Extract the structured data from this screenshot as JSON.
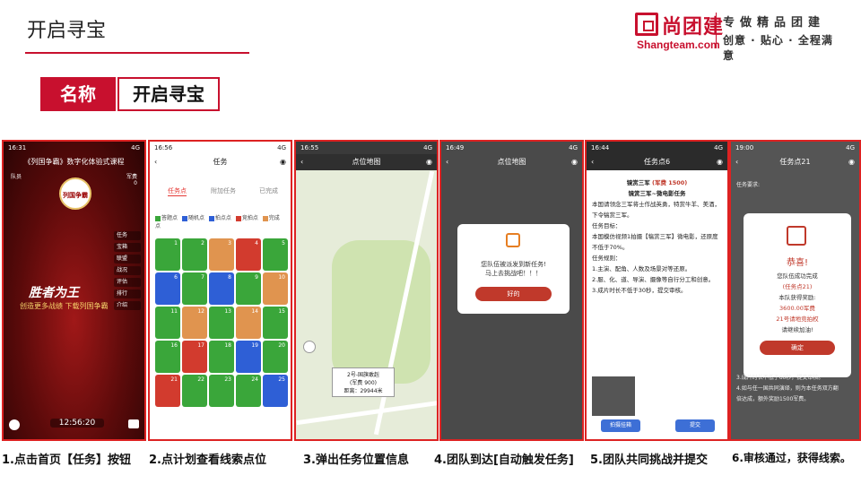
{
  "page_title": "开启寻宝",
  "logo": {
    "name": "尚团建",
    "domain": "Shangteam.com",
    "slogan_top": "专做精品团建",
    "slogan_bottom": "创意 · 贴心 · 全程满意"
  },
  "name_row": {
    "label": "名称",
    "value": "开启寻宝"
  },
  "phones": {
    "p1": {
      "time": "16:31",
      "signal": "4G",
      "title": "《列国争霸》数字化体验式课程",
      "team_label": "队员",
      "score_label": "军费",
      "score_value": "0",
      "emblem_text": "列国争霸",
      "side_menu": [
        "任务",
        "宝箱",
        "联盟",
        "战况",
        "评估",
        "排行",
        "介绍"
      ],
      "slogan": "胜者为王",
      "slogan_sub": "创造更多战绩 下载列国争霸",
      "timer": "12:56:20"
    },
    "p2": {
      "time": "16:56",
      "signal": "4G",
      "nav_title": "任务",
      "tabs": [
        "任务点",
        "附加任务",
        "已完成"
      ],
      "legend": [
        "答题点",
        "随机点",
        "拍点点",
        "竞拍点",
        "完成点"
      ],
      "cells": [
        {
          "n": "1",
          "c": "#3aa63a"
        },
        {
          "n": "2",
          "c": "#3aa63a"
        },
        {
          "n": "3",
          "c": "#e0944f"
        },
        {
          "n": "4",
          "c": "#d23b2e"
        },
        {
          "n": "5",
          "c": "#3aa63a"
        },
        {
          "n": "6",
          "c": "#2e5fd6"
        },
        {
          "n": "7",
          "c": "#3aa63a"
        },
        {
          "n": "8",
          "c": "#2e5fd6"
        },
        {
          "n": "9",
          "c": "#3aa63a"
        },
        {
          "n": "10",
          "c": "#e0944f"
        },
        {
          "n": "11",
          "c": "#3aa63a"
        },
        {
          "n": "12",
          "c": "#e0944f"
        },
        {
          "n": "13",
          "c": "#3aa63a"
        },
        {
          "n": "14",
          "c": "#e0944f"
        },
        {
          "n": "15",
          "c": "#3aa63a"
        },
        {
          "n": "16",
          "c": "#3aa63a"
        },
        {
          "n": "17",
          "c": "#d23b2e"
        },
        {
          "n": "18",
          "c": "#3aa63a"
        },
        {
          "n": "19",
          "c": "#2e5fd6"
        },
        {
          "n": "20",
          "c": "#3aa63a"
        },
        {
          "n": "21",
          "c": "#d23b2e"
        },
        {
          "n": "22",
          "c": "#3aa63a"
        },
        {
          "n": "23",
          "c": "#3aa63a"
        },
        {
          "n": "24",
          "c": "#3aa63a"
        },
        {
          "n": "25",
          "c": "#2e5fd6"
        }
      ]
    },
    "p3": {
      "time": "16:55",
      "signal": "4G",
      "nav_title": "点位地图",
      "info_line1": "2号-国旗敢赳",
      "info_line2": "(军费 900)",
      "info_line3": "距离：29944米"
    },
    "p4": {
      "time": "16:49",
      "signal": "4G",
      "nav_title": "点位地图",
      "modal_line1": "您队伍被派发到新任务!",
      "modal_line2": "马上去挑战吧！！！",
      "modal_button": "好的"
    },
    "p5": {
      "time": "16:44",
      "signal": "4G",
      "nav_title": "任务点6",
      "head1": "镜赏三军",
      "head1_fee": "(军费 1500)",
      "head2": "镜赏三军~微电影任务",
      "intro": "本国请领念三军将士作战英勇，特赏牛羊、美酒，下令犒赏三军。",
      "goal_title": "任务目标：",
      "goal": "本国模仿视频1拍摄【犒赏三军】微电影，还原度不低于70%。",
      "rule_title": "任务规则：",
      "rules": [
        "1.主演、配角、人数及场景对等还原。",
        "2.服、化、道、导演、摄像等自行分工和创意。",
        "3.成片时长不低于30秒，提交审核。"
      ],
      "btn_left": "拍摄挂箱",
      "btn_right": "提交"
    },
    "p6": {
      "time": "19:00",
      "signal": "4G",
      "nav_title": "任务点21",
      "req_label": "任务要求:",
      "modal_title": "恭喜!",
      "modal_lines": [
        "您队伍成功完成",
        "(任务点21)",
        "本队获得奖励:",
        "3600.00军费",
        "21号请地竞拍权",
        "请继续加油!"
      ],
      "modal_button": "确定",
      "after_lines": [
        "3.成片时长不低于60秒，提交审核。",
        "4.如与任一国共同演绎，则为本任务双方翻",
        "倍达成，额外奖励1500军费。"
      ]
    }
  },
  "captions": [
    "1.点击首页【任务】按钮",
    "2.点计划查看线索点位",
    "3.弹出任务位置信息",
    "4.团队到达[自动触发任务]",
    "5.团队共同挑战并提交",
    "6.审核通过，获得线索。"
  ]
}
